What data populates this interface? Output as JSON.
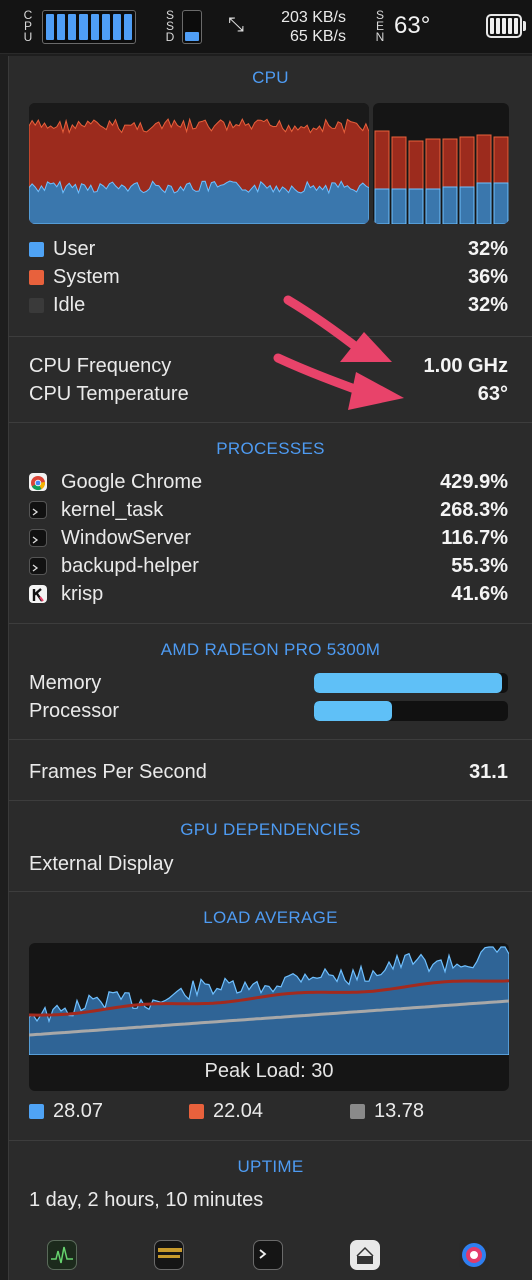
{
  "menubar": {
    "cpu_label": [
      "C",
      "P",
      "U"
    ],
    "ssd_label": [
      "S",
      "S",
      "D"
    ],
    "sensor_label": [
      "S",
      "E",
      "N"
    ],
    "net_up": "203 KB/s",
    "net_down": "65 KB/s",
    "temperature": "63°",
    "cpu_cores": 8,
    "ssd_fill_fraction": 0.3
  },
  "cpu": {
    "title": "CPU",
    "legend": [
      {
        "label": "User",
        "value": "32%",
        "color": "#4fa3f5"
      },
      {
        "label": "System",
        "value": "36%",
        "color": "#e8613c"
      },
      {
        "label": "Idle",
        "value": "32%",
        "color": "#3a3a3a"
      }
    ],
    "frequency_label": "CPU Frequency",
    "frequency_value": "1.00 GHz",
    "temperature_label": "CPU Temperature",
    "temperature_value": "63°",
    "history_colors": {
      "user": "#3a77ad",
      "system": "#9c2b1d",
      "idle": "#1a1a1a"
    }
  },
  "processes": {
    "title": "PROCESSES",
    "items": [
      {
        "name": "Google Chrome",
        "value": "429.9%",
        "icon": "chrome-icon"
      },
      {
        "name": "kernel_task",
        "value": "268.3%",
        "icon": "terminal-icon"
      },
      {
        "name": "WindowServer",
        "value": "116.7%",
        "icon": "terminal-icon"
      },
      {
        "name": "backupd-helper",
        "value": "55.3%",
        "icon": "terminal-icon"
      },
      {
        "name": "krisp",
        "value": "41.6%",
        "icon": "krisp-icon"
      }
    ]
  },
  "gpu": {
    "title": "AMD RADEON PRO 5300M",
    "memory_label": "Memory",
    "memory_fraction": 0.97,
    "processor_label": "Processor",
    "processor_fraction": 0.4,
    "fps_label": "Frames Per Second",
    "fps_value": "31.1"
  },
  "gpu_dependencies": {
    "title": "GPU DEPENDENCIES",
    "item": "External Display"
  },
  "load_average": {
    "title": "LOAD AVERAGE",
    "peak": "Peak Load: 30",
    "values": [
      {
        "value": "28.07",
        "color": "#4fa3f5"
      },
      {
        "value": "22.04",
        "color": "#e8613c"
      },
      {
        "value": "13.78",
        "color": "#8a8a8a"
      }
    ]
  },
  "uptime": {
    "title": "UPTIME",
    "value": "1 day, 2 hours, 10 minutes"
  },
  "dock_icons": [
    "activity-monitor-icon",
    "console-icon",
    "terminal-icon",
    "system-info-icon",
    "disk-utility-icon"
  ],
  "annotation_color": "#e8436a"
}
